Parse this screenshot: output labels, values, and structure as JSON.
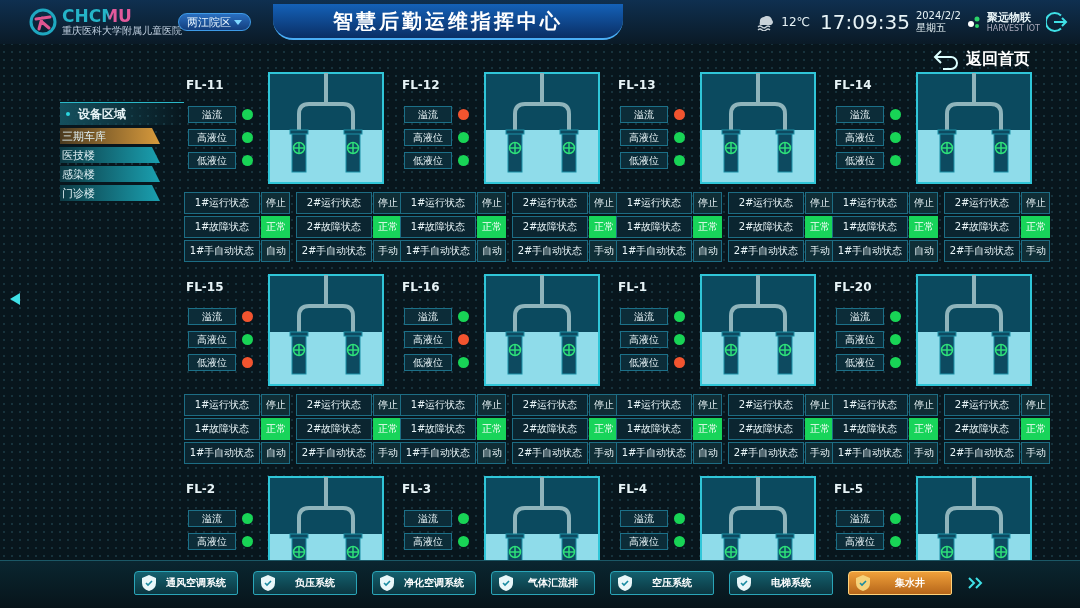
{
  "header": {
    "logo": "CHCMU",
    "logo_subtitle": "重庆医科大学附属儿童医院",
    "campus": "两江院区",
    "title": "智慧后勤运维指挥中心",
    "temperature": "12℃",
    "time": "17:09:35",
    "date": "2024/2/2",
    "weekday": "星期五",
    "brand": "聚远物联",
    "brand_sub": "HARVEST IOT"
  },
  "back": "返回首页",
  "sidebar": {
    "title": "设备区域",
    "items": [
      {
        "label": "三期车库",
        "selected": true
      },
      {
        "label": "医技楼",
        "selected": false
      },
      {
        "label": "感染楼",
        "selected": false
      },
      {
        "label": "门诊楼",
        "selected": false
      }
    ]
  },
  "units": [
    {
      "name": "FL-11",
      "indicators": [
        {
          "label": "溢流",
          "color": "#18d456"
        },
        {
          "label": "高液位",
          "color": "#18d456"
        },
        {
          "label": "低液位",
          "color": "#18d456"
        }
      ],
      "pumps": [
        {
          "cells": [
            {
              "label": "1#运行状态",
              "value": "停止",
              "on": false
            },
            {
              "label": "1#故障状态",
              "value": "正常",
              "on": true
            },
            {
              "label": "1#手自动状态",
              "value": "自动",
              "on": false
            }
          ]
        },
        {
          "cells": [
            {
              "label": "2#运行状态",
              "value": "停止",
              "on": false
            },
            {
              "label": "2#故障状态",
              "value": "正常",
              "on": true
            },
            {
              "label": "2#手自动状态",
              "value": "手动",
              "on": false
            }
          ]
        }
      ]
    },
    {
      "name": "FL-12",
      "indicators": [
        {
          "label": "溢流",
          "color": "#f2542f"
        },
        {
          "label": "高液位",
          "color": "#18d456"
        },
        {
          "label": "低液位",
          "color": "#18d456"
        }
      ],
      "pumps": [
        {
          "cells": [
            {
              "label": "1#运行状态",
              "value": "停止",
              "on": false
            },
            {
              "label": "1#故障状态",
              "value": "正常",
              "on": true
            },
            {
              "label": "1#手自动状态",
              "value": "自动",
              "on": false
            }
          ]
        },
        {
          "cells": [
            {
              "label": "2#运行状态",
              "value": "停止",
              "on": false
            },
            {
              "label": "2#故障状态",
              "value": "正常",
              "on": true
            },
            {
              "label": "2#手自动状态",
              "value": "手动",
              "on": false
            }
          ]
        }
      ]
    },
    {
      "name": "FL-13",
      "indicators": [
        {
          "label": "溢流",
          "color": "#f2542f"
        },
        {
          "label": "高液位",
          "color": "#18d456"
        },
        {
          "label": "低液位",
          "color": "#18d456"
        }
      ],
      "pumps": [
        {
          "cells": [
            {
              "label": "1#运行状态",
              "value": "停止",
              "on": false
            },
            {
              "label": "1#故障状态",
              "value": "正常",
              "on": true
            },
            {
              "label": "1#手自动状态",
              "value": "自动",
              "on": false
            }
          ]
        },
        {
          "cells": [
            {
              "label": "2#运行状态",
              "value": "停止",
              "on": false
            },
            {
              "label": "2#故障状态",
              "value": "正常",
              "on": true
            },
            {
              "label": "2#手自动状态",
              "value": "手动",
              "on": false
            }
          ]
        }
      ]
    },
    {
      "name": "FL-14",
      "indicators": [
        {
          "label": "溢流",
          "color": "#18d456"
        },
        {
          "label": "高液位",
          "color": "#18d456"
        },
        {
          "label": "低液位",
          "color": "#18d456"
        }
      ],
      "pumps": [
        {
          "cells": [
            {
              "label": "1#运行状态",
              "value": "停止",
              "on": false
            },
            {
              "label": "1#故障状态",
              "value": "正常",
              "on": true
            },
            {
              "label": "1#手自动状态",
              "value": "自动",
              "on": false
            }
          ]
        },
        {
          "cells": [
            {
              "label": "2#运行状态",
              "value": "停止",
              "on": false
            },
            {
              "label": "2#故障状态",
              "value": "正常",
              "on": true
            },
            {
              "label": "2#手自动状态",
              "value": "手动",
              "on": false
            }
          ]
        }
      ]
    },
    {
      "name": "FL-15",
      "indicators": [
        {
          "label": "溢流",
          "color": "#f2542f"
        },
        {
          "label": "高液位",
          "color": "#18d456"
        },
        {
          "label": "低液位",
          "color": "#f2542f"
        }
      ],
      "pumps": [
        {
          "cells": [
            {
              "label": "1#运行状态",
              "value": "停止",
              "on": false
            },
            {
              "label": "1#故障状态",
              "value": "正常",
              "on": true
            },
            {
              "label": "1#手自动状态",
              "value": "自动",
              "on": false
            }
          ]
        },
        {
          "cells": [
            {
              "label": "2#运行状态",
              "value": "停止",
              "on": false
            },
            {
              "label": "2#故障状态",
              "value": "正常",
              "on": true
            },
            {
              "label": "2#手自动状态",
              "value": "手动",
              "on": false
            }
          ]
        }
      ]
    },
    {
      "name": "FL-16",
      "indicators": [
        {
          "label": "溢流",
          "color": "#18d456"
        },
        {
          "label": "高液位",
          "color": "#f2542f"
        },
        {
          "label": "低液位",
          "color": "#18d456"
        }
      ],
      "pumps": [
        {
          "cells": [
            {
              "label": "1#运行状态",
              "value": "停止",
              "on": false
            },
            {
              "label": "1#故障状态",
              "value": "正常",
              "on": true
            },
            {
              "label": "1#手自动状态",
              "value": "自动",
              "on": false
            }
          ]
        },
        {
          "cells": [
            {
              "label": "2#运行状态",
              "value": "停止",
              "on": false
            },
            {
              "label": "2#故障状态",
              "value": "正常",
              "on": true
            },
            {
              "label": "2#手自动状态",
              "value": "手动",
              "on": false
            }
          ]
        }
      ]
    },
    {
      "name": "FL-1",
      "indicators": [
        {
          "label": "溢流",
          "color": "#18d456"
        },
        {
          "label": "高液位",
          "color": "#18d456"
        },
        {
          "label": "低液位",
          "color": "#f2542f"
        }
      ],
      "pumps": [
        {
          "cells": [
            {
              "label": "1#运行状态",
              "value": "停止",
              "on": false
            },
            {
              "label": "1#故障状态",
              "value": "正常",
              "on": true
            },
            {
              "label": "1#手自动状态",
              "value": "自动",
              "on": false
            }
          ]
        },
        {
          "cells": [
            {
              "label": "2#运行状态",
              "value": "停止",
              "on": false
            },
            {
              "label": "2#故障状态",
              "value": "正常",
              "on": true
            },
            {
              "label": "2#手自动状态",
              "value": "手动",
              "on": false
            }
          ]
        }
      ]
    },
    {
      "name": "FL-20",
      "indicators": [
        {
          "label": "溢流",
          "color": "#18d456"
        },
        {
          "label": "高液位",
          "color": "#18d456"
        },
        {
          "label": "低液位",
          "color": "#18d456"
        }
      ],
      "pumps": [
        {
          "cells": [
            {
              "label": "1#运行状态",
              "value": "停止",
              "on": false
            },
            {
              "label": "1#故障状态",
              "value": "正常",
              "on": true
            },
            {
              "label": "1#手自动状态",
              "value": "手动",
              "on": false
            }
          ]
        },
        {
          "cells": [
            {
              "label": "2#运行状态",
              "value": "停止",
              "on": false
            },
            {
              "label": "2#故障状态",
              "value": "正常",
              "on": true
            },
            {
              "label": "2#手自动状态",
              "value": "手动",
              "on": false
            }
          ]
        }
      ]
    },
    {
      "name": "FL-2",
      "indicators": [
        {
          "label": "溢流",
          "color": "#18d456"
        },
        {
          "label": "高液位",
          "color": "#18d456"
        }
      ]
    },
    {
      "name": "FL-3",
      "indicators": [
        {
          "label": "溢流",
          "color": "#18d456"
        },
        {
          "label": "高液位",
          "color": "#18d456"
        }
      ]
    },
    {
      "name": "FL-4",
      "indicators": [
        {
          "label": "溢流",
          "color": "#18d456"
        },
        {
          "label": "高液位",
          "color": "#18d456"
        }
      ]
    },
    {
      "name": "FL-5",
      "indicators": [
        {
          "label": "溢流",
          "color": "#18d456"
        },
        {
          "label": "高液位",
          "color": "#18d456"
        }
      ]
    }
  ],
  "systems": [
    {
      "label": "通风空调系统",
      "selected": false
    },
    {
      "label": "负压系统",
      "selected": false
    },
    {
      "label": "净化空调系统",
      "selected": false
    },
    {
      "label": "气体汇流排",
      "selected": false
    },
    {
      "label": "空压系统",
      "selected": false
    },
    {
      "label": "电梯系统",
      "selected": false
    },
    {
      "label": "集水井",
      "selected": true
    }
  ]
}
